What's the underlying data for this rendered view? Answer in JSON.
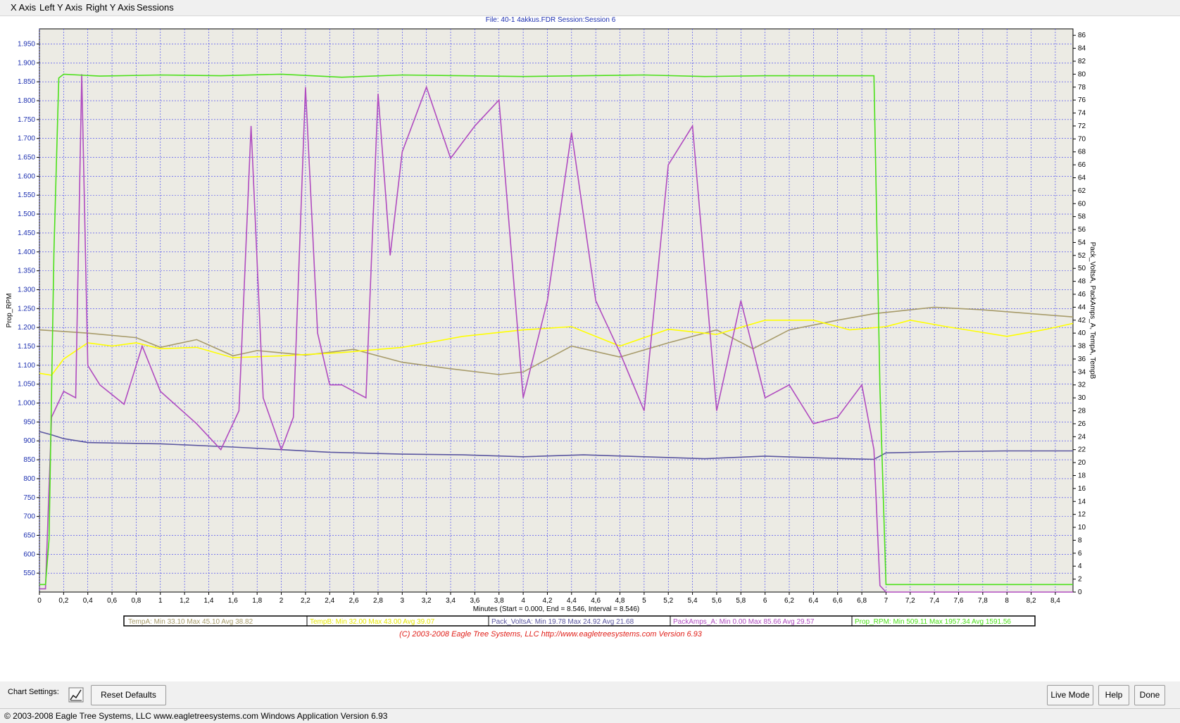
{
  "menu": {
    "x_axis": "X Axis",
    "left_y_axis": "Left Y Axis",
    "right_y_axis": "Right Y Axis",
    "sessions": "Sessions"
  },
  "chart_header": "File: 40-1 4akkus.FDR   Session:Session 6",
  "copyright_line": "(C) 2003-2008 Eagle Tree Systems, LLC     http://www.eagletreesystems.com     Version 6.93",
  "legend": [
    {
      "name": "TempA:",
      "min": "Min 33.10",
      "max": "Max 45.10",
      "avg": "Avg 38.82",
      "color": "#a79b6a"
    },
    {
      "name": "TempB:",
      "min": "Min 32.00",
      "max": "Max 43.00",
      "avg": "Avg 39.07",
      "color": "#e6e600"
    },
    {
      "name": "Pack_VoltsA:",
      "min": "Min 19.78",
      "max": "Max 24.92",
      "avg": "Avg 21.68",
      "color": "#5a56a0"
    },
    {
      "name": "PackAmps_A:",
      "min": "Min 0.00",
      "max": "Max 85.66",
      "avg": "Avg 29.57",
      "color": "#b04cc0"
    },
    {
      "name": "Prop_RPM:",
      "min": "Min 509.11",
      "max": "Max 1957.34",
      "avg": "Avg 1591.56",
      "color": "#4ce01a"
    }
  ],
  "bottom": {
    "chart_settings": "Chart Settings:",
    "reset_defaults": "Reset Defaults",
    "live_mode": "Live Mode",
    "help": "Help",
    "done": "Done"
  },
  "status": "© 2003-2008 Eagle Tree Systems, LLC    www.eagletreesystems.com    Windows Application Version 6.93",
  "chart_data": {
    "type": "line",
    "xlabel": "Minutes (Start = 0.000,  End = 8.546,  Interval = 8.546)",
    "ylabel": "Prop_RPM",
    "y2label": "Pack_VoltsA, PackAmps_A, TempA, TempB",
    "xlim": [
      0,
      8.546
    ],
    "ylim": [
      500,
      1990
    ],
    "y2lim": [
      0,
      87
    ],
    "x_ticks": [
      "0",
      "0,2",
      "0,4",
      "0,6",
      "0,8",
      "1",
      "1,2",
      "1,4",
      "1,6",
      "1,8",
      "2",
      "2,2",
      "2,4",
      "2,6",
      "2,8",
      "3",
      "3,2",
      "3,4",
      "3,6",
      "3,8",
      "4",
      "4,2",
      "4,4",
      "4,6",
      "4,8",
      "5",
      "5,2",
      "5,4",
      "5,6",
      "5,8",
      "6",
      "6,2",
      "6,4",
      "6,6",
      "6,8",
      "7",
      "7,2",
      "7,4",
      "7,6",
      "7,8",
      "8",
      "8,2",
      "8,4"
    ],
    "y_ticks": [
      "550",
      "600",
      "650",
      "700",
      "750",
      "800",
      "850",
      "900",
      "950",
      "1.000",
      "1.050",
      "1.100",
      "1.150",
      "1.200",
      "1.250",
      "1.300",
      "1.350",
      "1.400",
      "1.450",
      "1.500",
      "1.550",
      "1.600",
      "1.650",
      "1.700",
      "1.750",
      "1.800",
      "1.850",
      "1.900",
      "1.950"
    ],
    "y2_ticks": [
      "0",
      "2",
      "4",
      "6",
      "8",
      "10",
      "12",
      "14",
      "16",
      "18",
      "20",
      "22",
      "24",
      "26",
      "28",
      "30",
      "32",
      "34",
      "36",
      "38",
      "40",
      "42",
      "44",
      "46",
      "48",
      "50",
      "52",
      "54",
      "56",
      "58",
      "60",
      "62",
      "64",
      "66",
      "68",
      "70",
      "72",
      "74",
      "76",
      "78",
      "80",
      "82",
      "84",
      "86"
    ],
    "grid": true,
    "series": [
      {
        "name": "TempA",
        "axis": "right",
        "color": "#a79b6a",
        "x": [
          0,
          0.4,
          0.8,
          1.0,
          1.3,
          1.6,
          1.8,
          2.2,
          2.6,
          3.0,
          3.4,
          3.8,
          4.0,
          4.4,
          4.8,
          5.2,
          5.6,
          5.9,
          6.2,
          6.6,
          6.9,
          7.2,
          7.4,
          7.8,
          8.2,
          8.546
        ],
        "y": [
          40.5,
          40,
          39.3,
          37.8,
          39,
          36.5,
          37.3,
          36.6,
          37.5,
          35.5,
          34.5,
          33.6,
          34,
          38,
          36.3,
          38.5,
          40.5,
          37.6,
          40.5,
          42,
          43,
          43.6,
          44,
          43.6,
          43,
          42.5
        ]
      },
      {
        "name": "TempB",
        "axis": "right",
        "color": "#ffff00",
        "x": [
          0,
          0.1,
          0.2,
          0.4,
          0.6,
          0.8,
          1.0,
          1.3,
          1.6,
          2.0,
          2.5,
          3.0,
          3.5,
          4.0,
          4.4,
          4.8,
          5.2,
          5.6,
          6.0,
          6.4,
          6.7,
          7.0,
          7.2,
          7.5,
          8.0,
          8.3,
          8.546
        ],
        "y": [
          33.8,
          33.5,
          36,
          38.5,
          38,
          38.5,
          37.6,
          37.8,
          36.2,
          36.5,
          37,
          37.8,
          39.5,
          40.5,
          41,
          38,
          40.6,
          39.8,
          42,
          42,
          40.5,
          41,
          42,
          41,
          39.5,
          40.5,
          41.5
        ]
      },
      {
        "name": "Pack_VoltsA",
        "axis": "right",
        "color": "#5a56a0",
        "x": [
          0,
          0.1,
          0.2,
          0.4,
          1.0,
          1.6,
          2.0,
          2.4,
          3.0,
          3.5,
          4.0,
          4.5,
          5.0,
          5.5,
          6.0,
          6.5,
          6.9,
          7.0,
          7.5,
          8.0,
          8.546
        ],
        "y": [
          24.8,
          24.3,
          23.7,
          23.1,
          22.9,
          22.4,
          22.0,
          21.6,
          21.3,
          21.2,
          20.9,
          21.2,
          20.9,
          20.6,
          21.0,
          20.7,
          20.5,
          21.5,
          21.7,
          21.8,
          21.8
        ]
      },
      {
        "name": "PackAmps_A",
        "axis": "right",
        "color": "#b04cc0",
        "x": [
          0,
          0.05,
          0.1,
          0.2,
          0.3,
          0.35,
          0.4,
          0.5,
          0.7,
          0.85,
          1.0,
          1.3,
          1.5,
          1.65,
          1.75,
          1.85,
          2.0,
          2.1,
          2.2,
          2.3,
          2.4,
          2.5,
          2.7,
          2.8,
          2.9,
          3.0,
          3.2,
          3.4,
          3.6,
          3.8,
          4.0,
          4.2,
          4.4,
          4.6,
          4.8,
          5.0,
          5.2,
          5.4,
          5.6,
          5.8,
          6.0,
          6.2,
          6.4,
          6.6,
          6.8,
          6.9,
          6.95,
          7.0,
          8.546
        ],
        "y": [
          0.5,
          0.5,
          27,
          31,
          30,
          80,
          35,
          32,
          29,
          38,
          31,
          26,
          22,
          28,
          72,
          30,
          22,
          27,
          78,
          40,
          32,
          32,
          30,
          77,
          52,
          68,
          78,
          67,
          72,
          76,
          30,
          45,
          71,
          45,
          37,
          28,
          66,
          72,
          28,
          45,
          30,
          32,
          26,
          27,
          32,
          22,
          1,
          0,
          0
        ]
      },
      {
        "name": "Prop_RPM",
        "axis": "left",
        "color": "#4ce01a",
        "x": [
          0,
          0.05,
          0.08,
          0.12,
          0.16,
          0.2,
          0.5,
          1.0,
          1.5,
          2.0,
          2.5,
          3.0,
          3.5,
          4.0,
          4.5,
          5.0,
          5.5,
          6.0,
          6.5,
          6.9,
          6.95,
          7.0,
          8.546
        ],
        "y": [
          520,
          520,
          640,
          1400,
          1860,
          1870,
          1865,
          1868,
          1866,
          1870,
          1862,
          1868,
          1866,
          1864,
          1866,
          1868,
          1864,
          1866,
          1866,
          1866,
          1040,
          520,
          520
        ]
      }
    ]
  }
}
